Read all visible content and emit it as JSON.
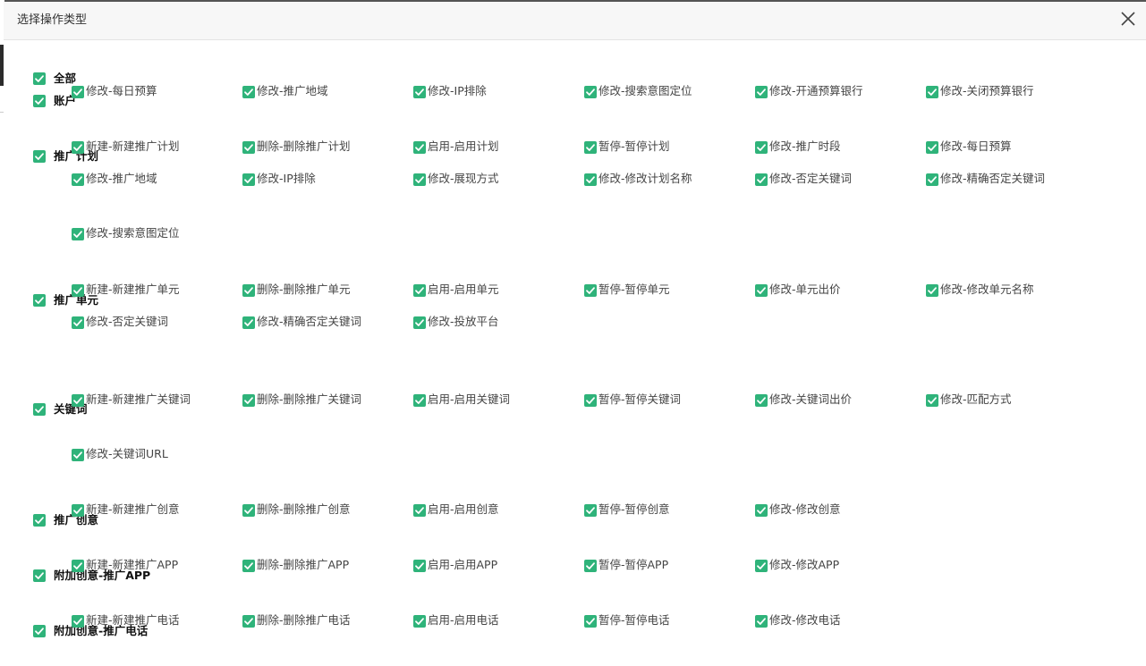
{
  "dialog": {
    "title": "选择操作类型"
  },
  "colors": {
    "checkbox": "#2fb37a"
  },
  "icons": {
    "close": "close-icon",
    "checkbox": "checkbox-checked-icon"
  },
  "all": {
    "label": "全部"
  },
  "categories": [
    {
      "label": "账户",
      "items": [
        "修改-每日预算",
        "修改-推广地域",
        "修改-IP排除",
        "修改-搜索意图定位",
        "修改-开通预算银行",
        "修改-关闭预算银行"
      ]
    },
    {
      "label": "推广计划",
      "items": [
        "新建-新建推广计划",
        "删除-删除推广计划",
        "启用-启用计划",
        "暂停-暂停计划",
        "修改-推广时段",
        "修改-每日预算",
        "修改-推广地域",
        "修改-IP排除",
        "修改-展现方式",
        "修改-修改计划名称",
        "修改-否定关键词",
        "修改-精确否定关键词",
        "修改-搜索意图定位"
      ]
    },
    {
      "label": "推广单元",
      "items": [
        "新建-新建推广单元",
        "删除-删除推广单元",
        "启用-启用单元",
        "暂停-暂停单元",
        "修改-单元出价",
        "修改-修改单元名称",
        "修改-否定关键词",
        "修改-精确否定关键词",
        "修改-投放平台"
      ]
    },
    {
      "label": "关键词",
      "items": [
        "新建-新建推广关键词",
        "删除-删除推广关键词",
        "启用-启用关键词",
        "暂停-暂停关键词",
        "修改-关键词出价",
        "修改-匹配方式",
        "修改-关键词URL"
      ]
    },
    {
      "label": "推广创意",
      "items": [
        "新建-新建推广创意",
        "删除-删除推广创意",
        "启用-启用创意",
        "暂停-暂停创意",
        "修改-修改创意"
      ]
    },
    {
      "label": "附加创意-推广APP",
      "items": [
        "新建-新建推广APP",
        "删除-删除推广APP",
        "启用-启用APP",
        "暂停-暂停APP",
        "修改-修改APP"
      ]
    },
    {
      "label": "附加创意-推广电话",
      "items": [
        "新建-新建推广电话",
        "删除-删除推广电话",
        "启用-启用电话",
        "暂停-暂停电话",
        "修改-修改电话"
      ]
    }
  ]
}
